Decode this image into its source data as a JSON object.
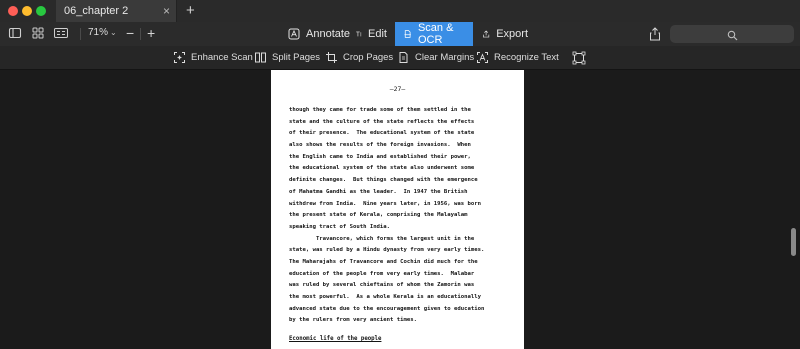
{
  "tab": {
    "title": "06_chapter 2",
    "close": "×",
    "new": "+"
  },
  "toolbar": {
    "zoom": "71%",
    "zoom_out": "−",
    "zoom_in": "+",
    "modes": [
      {
        "label": "Annotate",
        "icon": "annotate-icon",
        "active": false
      },
      {
        "label": "Edit",
        "icon": "text-edit-icon",
        "active": false
      },
      {
        "label": "Scan & OCR",
        "icon": "scan-ocr-icon",
        "active": true
      },
      {
        "label": "Export",
        "icon": "export-icon",
        "active": false
      }
    ]
  },
  "ocr_tools": [
    {
      "label": "Enhance Scan",
      "icon": "enhance-scan-icon"
    },
    {
      "label": "Split Pages",
      "icon": "split-pages-icon"
    },
    {
      "label": "Crop Pages",
      "icon": "crop-pages-icon"
    },
    {
      "label": "Clear Margins",
      "icon": "clear-margins-icon"
    },
    {
      "label": "Recognize Text",
      "icon": "recognize-text-icon"
    }
  ],
  "document": {
    "page_number": "—27—",
    "lines": [
      "though they came for trade some of them settled in the",
      "state and the culture of the state reflects the effects",
      "of their presence.  The educational system of the state",
      "also shows the results of the foreign invasions.  When",
      "the English came to India and established their power,",
      "the educational system of the state also underwent some",
      "definite changes.  But things changed with the emergence",
      "of Mahatma Gandhi as the leader.  In 1947 the British",
      "withdrew from India.  Nine years later, in 1956, was born",
      "the present state of Kerala, comprising the Malayalam",
      "speaking tract of South India.",
      "        Travancore, which forms the largest unit in the",
      "state, was ruled by a Hindu dynasty from very early times.",
      "The Maharajahs of Travancore and Cochin did much for the",
      "education of the people from very early times.  Malabar",
      "was ruled by several chieftains of whom the Zamorin was",
      "the most powerful.  As a whole Kerala is an educationally",
      "advanced state due to the encouragement given to education",
      "by the rulers from very ancient times."
    ],
    "section_heading": "Economic life of the people"
  }
}
